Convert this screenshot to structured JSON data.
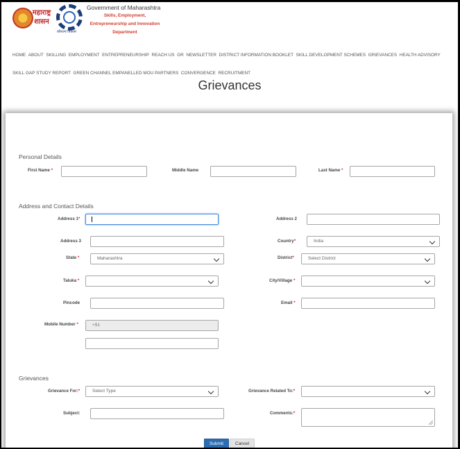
{
  "header": {
    "logo1_text": "महाराष्ट्र शासन",
    "logo2_sub": "कौशल्य विकास",
    "gov_title": "Government of Maharashtra",
    "dept_name": "Skills, Employment, Entrepreneurship and Innovation Department"
  },
  "nav": {
    "items": [
      "HOME",
      "ABOUT",
      "SKILLING",
      "EMPLOYMENT",
      "ENTREPRENEURSHIP",
      "REACH US",
      "GR",
      "NEWSLETTER",
      "DISTRICT INFORMATION BOOKLET",
      "SKILL DEVELOPMENT SCHEMES",
      "GRIEVANCES",
      "HEALTH ADVISORY",
      "SKILL GAP STUDY REPORT",
      "GREEN CHANNEL EMPANELLED MOU PARTNERS",
      "CONVERGENCE",
      "RECRUITMENT"
    ]
  },
  "page_title": "Grievances",
  "form": {
    "personal_heading": "Personal Details",
    "first_name_label": "First Name",
    "middle_name_label": "Middle Name",
    "last_name_label": "Last Name",
    "address_heading": "Address and Contact Details",
    "address1_label": "Address 1",
    "address2_label": "Address 2",
    "address3_label": "Address 3",
    "country_label": "Country",
    "country_value": "India",
    "state_label": "State",
    "state_value": "Maharashtra",
    "district_label": "District",
    "district_value": "Select District",
    "taluka_label": "Taluka",
    "city_label": "City/Village",
    "pincode_label": "Pincode",
    "email_label": "Email",
    "mobile_label": "Mobile Number",
    "mobile_prefix": "+91",
    "grievances_heading": "Grievances",
    "grievance_for_label": "Grievance For:",
    "grievance_for_value": "Select Type",
    "grievance_related_label": "Grievance Related To:",
    "subject_label": "Subject:",
    "comments_label": "Comments:",
    "required_mark": "*",
    "submit_label": "Submit",
    "cancel_label": "Cancel"
  },
  "colors": {
    "required": "#d9232e",
    "submit": "#2c6cb0",
    "focus": "#4a90d9"
  }
}
